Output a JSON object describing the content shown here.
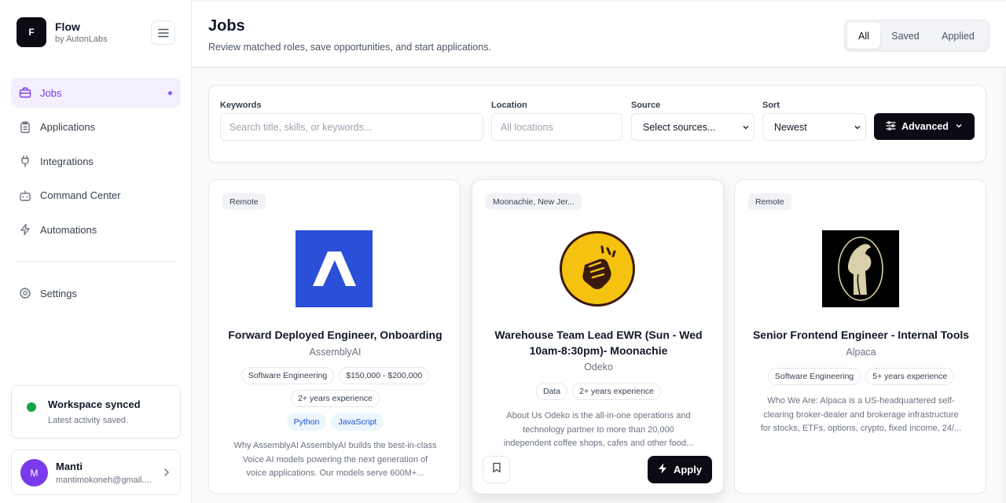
{
  "brand": {
    "logo_letter": "F",
    "name": "Flow",
    "sub": "by AutonLabs"
  },
  "sidebar": {
    "items": [
      {
        "label": "Jobs",
        "icon": "briefcase-icon",
        "active": true
      },
      {
        "label": "Applications",
        "icon": "clipboard-icon"
      },
      {
        "label": "Integrations",
        "icon": "plug-icon"
      },
      {
        "label": "Command Center",
        "icon": "bot-icon"
      },
      {
        "label": "Automations",
        "icon": "zap-icon"
      }
    ],
    "settings": {
      "label": "Settings",
      "icon": "gear-icon"
    },
    "sync": {
      "title": "Workspace synced",
      "sub": "Latest activity saved."
    },
    "user": {
      "initial": "M",
      "name": "Manti",
      "email": "mantimokoneh@gmail...."
    }
  },
  "header": {
    "title": "Jobs",
    "subtitle": "Review matched roles, save opportunities, and start applications.",
    "tabs": [
      "All",
      "Saved",
      "Applied"
    ],
    "active_tab": "All"
  },
  "filters": {
    "keywords_label": "Keywords",
    "keywords_placeholder": "Search title, skills, or keywords...",
    "location_label": "Location",
    "location_placeholder": "All locations",
    "source_label": "Source",
    "source_value": "Select sources...",
    "sort_label": "Sort",
    "sort_value": "Newest",
    "advanced_label": "Advanced"
  },
  "jobs": [
    {
      "location": "Remote",
      "title": "Forward Deployed Engineer, Onboarding",
      "company": "AssemblyAI",
      "tags_row1": [
        "Software Engineering",
        "$150,000 - $200,000"
      ],
      "tags_row2": [
        "2+ years experience"
      ],
      "skills": [
        "Python",
        "JavaScript"
      ],
      "description": [
        "Why AssemblyAI AssemblyAI builds the best-in-class",
        "Voice AI models powering the next generation of",
        "voice applications. Our models serve 600M+..."
      ]
    },
    {
      "location": "Moonachie, New Jer...",
      "title_lines": [
        "Warehouse Team Lead EWR (Sun - Wed",
        "10am-8:30pm)- Moonachie"
      ],
      "company": "Odeko",
      "tags_row1": [
        "Data",
        "2+ years experience"
      ],
      "description": [
        "About Us Odeko is the all-in-one operations and",
        "technology partner to more than 20,000",
        "independent coffee shops, cafes and other food..."
      ],
      "apply_label": "Apply"
    },
    {
      "location": "Remote",
      "title": "Senior Frontend Engineer - Internal Tools",
      "company": "Alpaca",
      "tags_row1": [
        "Software Engineering",
        "5+ years experience"
      ],
      "description": [
        "Who We Are: Alpaca is a US-headquartered self-",
        "clearing broker-dealer and brokerage infrastructure",
        "for stocks, ETFs, options, crypto, fixed income, 24/..."
      ]
    }
  ],
  "colors": {
    "accent": "#7c3aed",
    "primary_button": "#0b0b14",
    "assemblyai_logo": "#2b4fd8",
    "odeko_logo": "#f5c30f",
    "alpaca_logo": "#000000",
    "sync_ok": "#16a34a"
  }
}
